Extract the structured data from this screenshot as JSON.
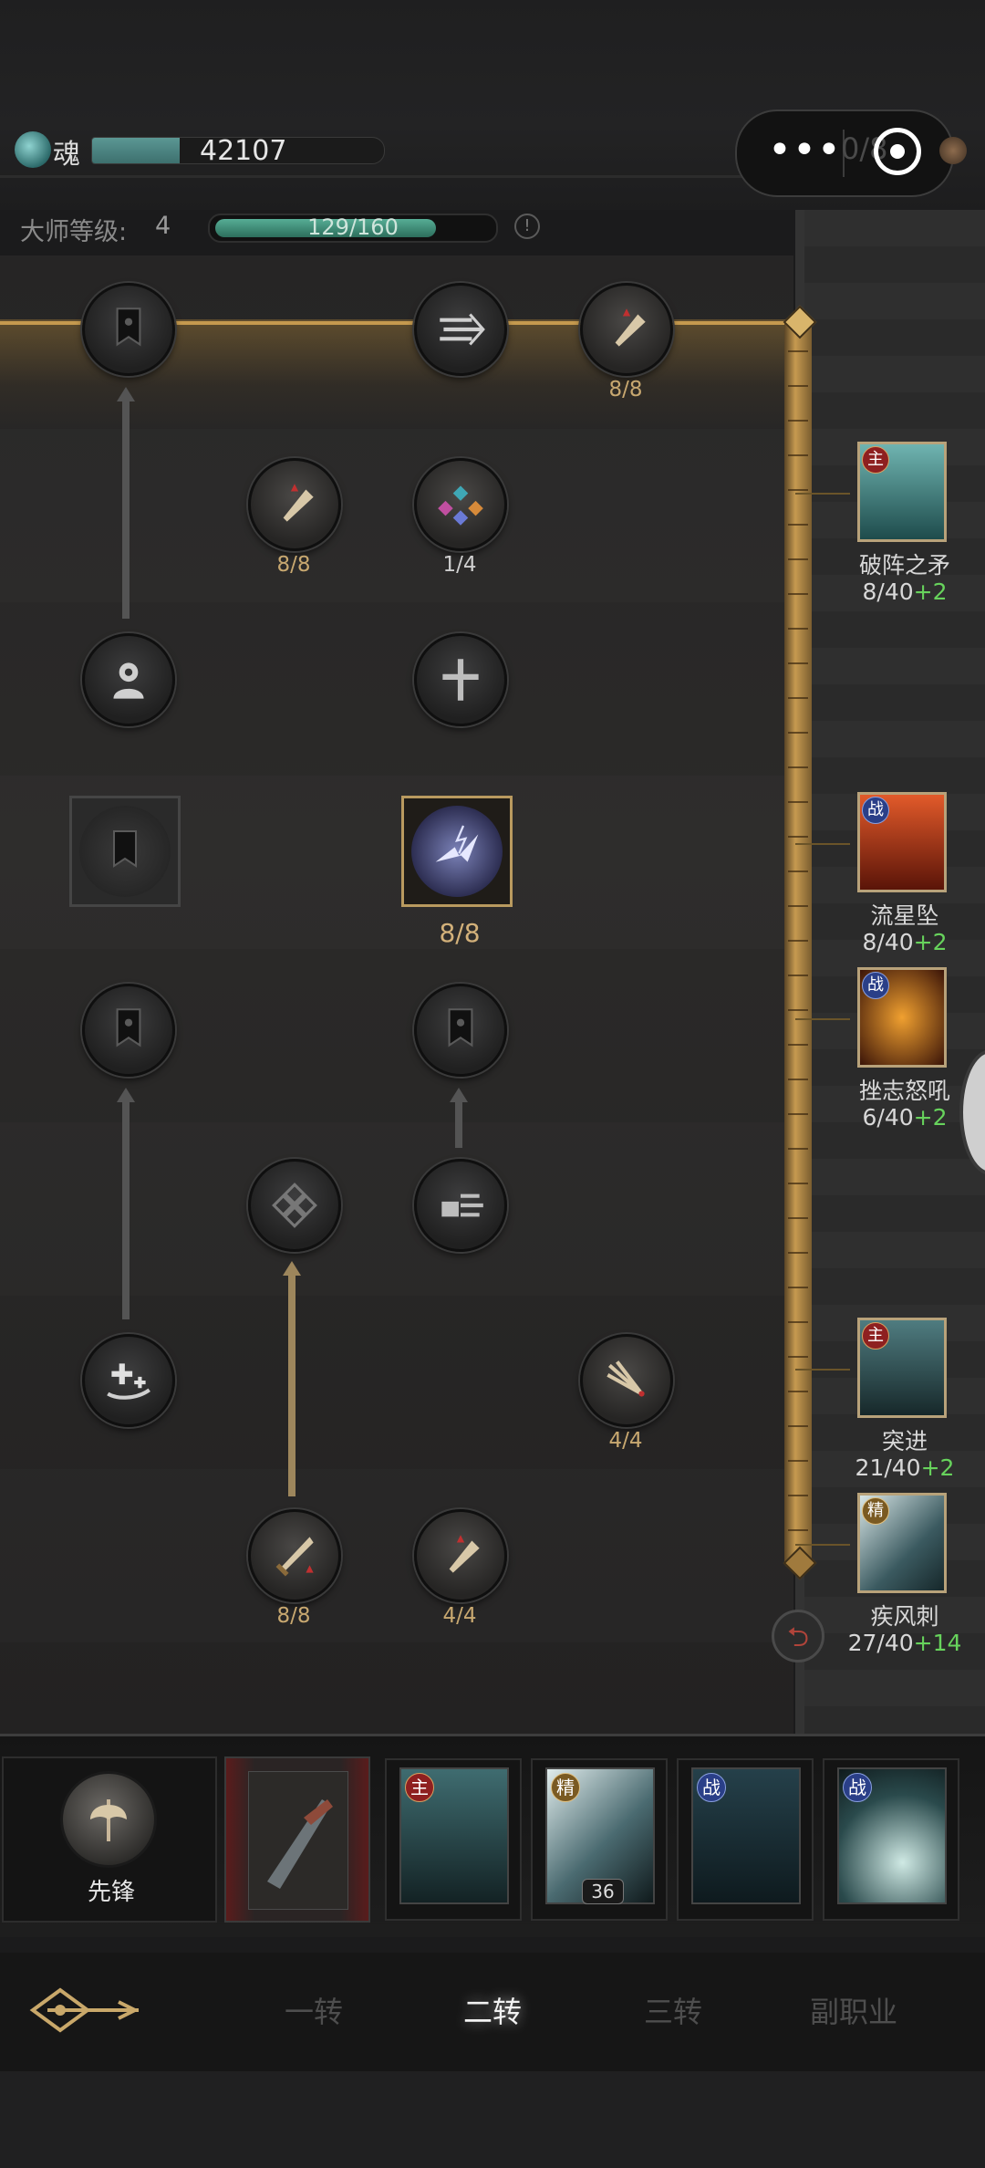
{
  "header": {
    "soul_label": "魂",
    "soul_value": "42107",
    "soul_fill": 0.3,
    "capsule_fraction": "0/8",
    "master_label": "大师等级:",
    "master_level": "4",
    "master_progress_text": "129/160",
    "master_progress": 0.806,
    "info_glyph": "!"
  },
  "tree": {
    "nodes": [
      {
        "id": "banner-1",
        "icon": "banner-icon",
        "count": ""
      },
      {
        "id": "wind-1",
        "icon": "wind-arrow-icon",
        "count": ""
      },
      {
        "id": "dagger-up-1",
        "icon": "dagger-up-icon",
        "count": "8/8"
      },
      {
        "id": "dagger-up-2",
        "icon": "dagger-up-icon",
        "count": "8/8"
      },
      {
        "id": "gem-cluster",
        "icon": "gem-cluster-icon",
        "count": "1/4"
      },
      {
        "id": "spirit",
        "icon": "spirit-icon",
        "count": ""
      },
      {
        "id": "cross",
        "icon": "cross-icon",
        "count": ""
      },
      {
        "id": "banner-square",
        "icon": "banner-icon",
        "count": ""
      },
      {
        "id": "lightning-strike",
        "icon": "lightning-figure-icon",
        "count": "8/8"
      },
      {
        "id": "banner-2",
        "icon": "banner-icon",
        "count": ""
      },
      {
        "id": "banner-3",
        "icon": "banner-icon",
        "count": ""
      },
      {
        "id": "diamond-knot",
        "icon": "diamond-knot-icon",
        "count": ""
      },
      {
        "id": "fist-dash",
        "icon": "fist-dash-icon",
        "count": ""
      },
      {
        "id": "heal-hand",
        "icon": "heal-hand-icon",
        "count": ""
      },
      {
        "id": "triple-blade",
        "icon": "triple-blade-icon",
        "count": "4/4"
      },
      {
        "id": "sword-up",
        "icon": "sword-up-icon",
        "count": "8/8"
      },
      {
        "id": "dagger-up-3",
        "icon": "dagger-up-icon",
        "count": "4/4"
      }
    ]
  },
  "rail_skills": [
    {
      "badge": "主",
      "name": "破阵之矛",
      "level": "8/40",
      "bonus": "+2",
      "color": "#2c6a6a"
    },
    {
      "badge": "战",
      "name": "流星坠",
      "level": "8/40",
      "bonus": "+2",
      "color": "#b3401c"
    },
    {
      "badge": "战",
      "name": "挫志怒吼",
      "level": "6/40",
      "bonus": "+2",
      "color": "#a84a1a"
    },
    {
      "badge": "主",
      "name": "突进",
      "level": "21/40",
      "bonus": "+2",
      "color": "#2d4d50"
    },
    {
      "badge": "精",
      "name": "疾风刺",
      "level": "27/40",
      "bonus": "+14",
      "color": "#3b5a60"
    }
  ],
  "skill_bar": {
    "class_name": "先锋",
    "skills": [
      {
        "badge": "主",
        "count": "",
        "icon": "dash-runner-icon"
      },
      {
        "badge": "精",
        "count": "36",
        "icon": "blade-slash-icon"
      },
      {
        "badge": "战",
        "count": "",
        "icon": "kick-icon"
      },
      {
        "badge": "战",
        "count": "",
        "icon": "wave-splash-icon"
      }
    ]
  },
  "tabs": [
    "一转",
    "二转",
    "三转",
    "副职业"
  ],
  "active_tab": "二转",
  "back_glyph": "⮌",
  "colors": {
    "gold": "#c59a4e",
    "bonus_green": "#67d35c",
    "node_count": "#c8a870"
  }
}
